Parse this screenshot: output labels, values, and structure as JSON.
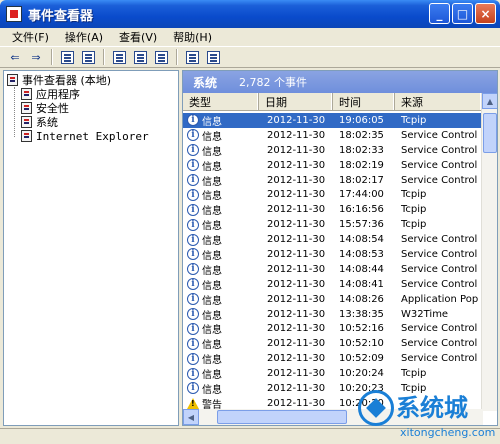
{
  "window": {
    "title": "事件查看器",
    "buttons": {
      "minimize": "_",
      "maximize": "□",
      "close": "×"
    }
  },
  "menu": [
    "文件(F)",
    "操作(A)",
    "查看(V)",
    "帮助(H)"
  ],
  "toolbar": {
    "back": "⇐",
    "forward": "⇒",
    "icons": [
      "up-folder-icon",
      "show-tree-icon",
      "properties-icon",
      "refresh-icon",
      "export-icon",
      "help-icon",
      "view-icon"
    ]
  },
  "tree": {
    "root": "事件查看器 (本地)",
    "children": [
      "应用程序",
      "安全性",
      "系统",
      "Internet Explorer"
    ]
  },
  "panel": {
    "log_name": "系统",
    "event_count": "2,782 个事件"
  },
  "columns": [
    "类型",
    "日期",
    "时间",
    "来源"
  ],
  "events": [
    {
      "type": "信息",
      "date": "2012-11-30",
      "time": "19:06:05",
      "source": "Tcpip",
      "icon": "info",
      "selected": true
    },
    {
      "type": "信息",
      "date": "2012-11-30",
      "time": "18:02:35",
      "source": "Service Control",
      "icon": "info"
    },
    {
      "type": "信息",
      "date": "2012-11-30",
      "time": "18:02:33",
      "source": "Service Control",
      "icon": "info"
    },
    {
      "type": "信息",
      "date": "2012-11-30",
      "time": "18:02:19",
      "source": "Service Control",
      "icon": "info"
    },
    {
      "type": "信息",
      "date": "2012-11-30",
      "time": "18:02:17",
      "source": "Service Control",
      "icon": "info"
    },
    {
      "type": "信息",
      "date": "2012-11-30",
      "time": "17:44:00",
      "source": "Tcpip",
      "icon": "info"
    },
    {
      "type": "信息",
      "date": "2012-11-30",
      "time": "16:16:56",
      "source": "Tcpip",
      "icon": "info"
    },
    {
      "type": "信息",
      "date": "2012-11-30",
      "time": "15:57:36",
      "source": "Tcpip",
      "icon": "info"
    },
    {
      "type": "信息",
      "date": "2012-11-30",
      "time": "14:08:54",
      "source": "Service Control",
      "icon": "info"
    },
    {
      "type": "信息",
      "date": "2012-11-30",
      "time": "14:08:53",
      "source": "Service Control",
      "icon": "info"
    },
    {
      "type": "信息",
      "date": "2012-11-30",
      "time": "14:08:44",
      "source": "Service Control",
      "icon": "info"
    },
    {
      "type": "信息",
      "date": "2012-11-30",
      "time": "14:08:41",
      "source": "Service Control",
      "icon": "info"
    },
    {
      "type": "信息",
      "date": "2012-11-30",
      "time": "14:08:26",
      "source": "Application Pop",
      "icon": "info"
    },
    {
      "type": "信息",
      "date": "2012-11-30",
      "time": "13:38:35",
      "source": "W32Time",
      "icon": "info"
    },
    {
      "type": "信息",
      "date": "2012-11-30",
      "time": "10:52:16",
      "source": "Service Control",
      "icon": "info"
    },
    {
      "type": "信息",
      "date": "2012-11-30",
      "time": "10:52:10",
      "source": "Service Control",
      "icon": "info"
    },
    {
      "type": "信息",
      "date": "2012-11-30",
      "time": "10:52:09",
      "source": "Service Control",
      "icon": "info"
    },
    {
      "type": "信息",
      "date": "2012-11-30",
      "time": "10:20:24",
      "source": "Tcpip",
      "icon": "info"
    },
    {
      "type": "信息",
      "date": "2012-11-30",
      "time": "10:20:23",
      "source": "Tcpip",
      "icon": "info"
    },
    {
      "type": "警告",
      "date": "2012-11-30",
      "time": "10:20:20",
      "source": "",
      "icon": "warning"
    }
  ],
  "watermark": {
    "title": "系统城",
    "subtitle": "xitongcheng.com"
  },
  "colors": {
    "selection": "#316ac5",
    "titlebar": "#0a4bcc",
    "panel_header": "#7a96df"
  }
}
